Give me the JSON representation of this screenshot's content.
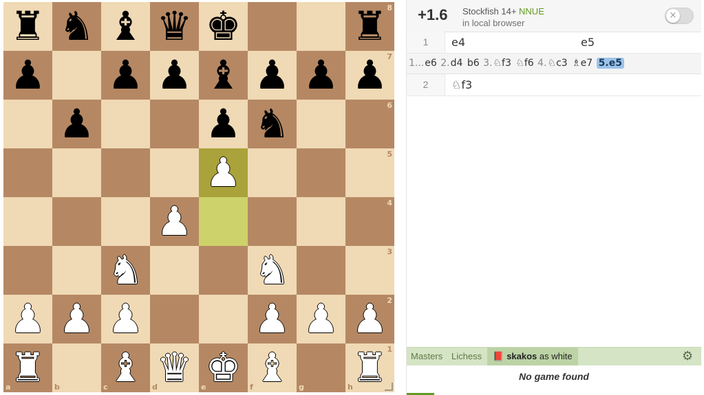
{
  "board": {
    "files": [
      "a",
      "b",
      "c",
      "d",
      "e",
      "f",
      "g",
      "h"
    ],
    "ranks": [
      "8",
      "7",
      "6",
      "5",
      "4",
      "3",
      "2",
      "1"
    ],
    "last_move": {
      "from": "e4",
      "to": "e5"
    },
    "pieces": {
      "a8": {
        "glyph": "♜",
        "color": "b",
        "name": "black-rook"
      },
      "b8": {
        "glyph": "♞",
        "color": "b",
        "name": "black-knight"
      },
      "c8": {
        "glyph": "♝",
        "color": "b",
        "name": "black-bishop"
      },
      "d8": {
        "glyph": "♛",
        "color": "b",
        "name": "black-queen"
      },
      "e8": {
        "glyph": "♚",
        "color": "b",
        "name": "black-king"
      },
      "h8": {
        "glyph": "♜",
        "color": "b",
        "name": "black-rook"
      },
      "a7": {
        "glyph": "♟",
        "color": "b",
        "name": "black-pawn"
      },
      "c7": {
        "glyph": "♟",
        "color": "b",
        "name": "black-pawn"
      },
      "d7": {
        "glyph": "♟",
        "color": "b",
        "name": "black-pawn"
      },
      "e7": {
        "glyph": "♝",
        "color": "b",
        "name": "black-bishop"
      },
      "f7": {
        "glyph": "♟",
        "color": "b",
        "name": "black-pawn"
      },
      "g7": {
        "glyph": "♟",
        "color": "b",
        "name": "black-pawn"
      },
      "h7": {
        "glyph": "♟",
        "color": "b",
        "name": "black-pawn"
      },
      "b6": {
        "glyph": "♟",
        "color": "b",
        "name": "black-pawn"
      },
      "e6": {
        "glyph": "♟",
        "color": "b",
        "name": "black-pawn"
      },
      "f6": {
        "glyph": "♞",
        "color": "b",
        "name": "black-knight"
      },
      "e5": {
        "glyph": "♟",
        "color": "w",
        "name": "white-pawn"
      },
      "d4": {
        "glyph": "♟",
        "color": "w",
        "name": "white-pawn"
      },
      "c3": {
        "glyph": "♞",
        "color": "w",
        "name": "white-knight"
      },
      "f3": {
        "glyph": "♞",
        "color": "w",
        "name": "white-knight"
      },
      "a2": {
        "glyph": "♟",
        "color": "w",
        "name": "white-pawn"
      },
      "b2": {
        "glyph": "♟",
        "color": "w",
        "name": "white-pawn"
      },
      "c2": {
        "glyph": "♟",
        "color": "w",
        "name": "white-pawn"
      },
      "f2": {
        "glyph": "♟",
        "color": "w",
        "name": "white-pawn"
      },
      "g2": {
        "glyph": "♟",
        "color": "w",
        "name": "white-pawn"
      },
      "h2": {
        "glyph": "♟",
        "color": "w",
        "name": "white-pawn"
      },
      "a1": {
        "glyph": "♜",
        "color": "w",
        "name": "white-rook"
      },
      "c1": {
        "glyph": "♝",
        "color": "w",
        "name": "white-bishop"
      },
      "d1": {
        "glyph": "♛",
        "color": "w",
        "name": "white-queen"
      },
      "e1": {
        "glyph": "♚",
        "color": "w",
        "name": "white-king"
      },
      "f1": {
        "glyph": "♝",
        "color": "w",
        "name": "white-bishop"
      },
      "h1": {
        "glyph": "♜",
        "color": "w",
        "name": "white-rook"
      }
    }
  },
  "ceval": {
    "score": "+1.6",
    "engine": "Stockfish 14+",
    "nnue": "NNUE",
    "location": "in local browser",
    "toggle_icon": "×"
  },
  "moves": {
    "row1": {
      "index": "1",
      "white": "e4",
      "black": "e5"
    },
    "pv": [
      {
        "num": "1...",
        "move": "e6"
      },
      {
        "num": "2.",
        "move": "d4"
      },
      {
        "num": "",
        "move": "b6"
      },
      {
        "num": "3.",
        "move": "♘f3"
      },
      {
        "num": "",
        "move": "♘f6"
      },
      {
        "num": "4.",
        "move": "♘c3"
      },
      {
        "num": "",
        "move": "♗e7"
      }
    ],
    "pv_current": {
      "num": "5.",
      "move": "e5"
    },
    "row2": {
      "index": "2",
      "white": "♘f3"
    }
  },
  "explorer": {
    "tab_masters": "Masters",
    "tab_lichess": "Lichess",
    "player_icon": "book-icon",
    "player_name": "skakos",
    "player_suffix": " as white",
    "gear_icon": "gear-icon",
    "empty_message": "No game found"
  },
  "colors": {
    "light_square": "#f0d9b5",
    "dark_square": "#b58863",
    "last_move_from": "#cdd26a",
    "last_move_to": "#aaa23a",
    "explorer_bar": "#d4e4c4",
    "pv_highlight": "#9cc3ea"
  }
}
